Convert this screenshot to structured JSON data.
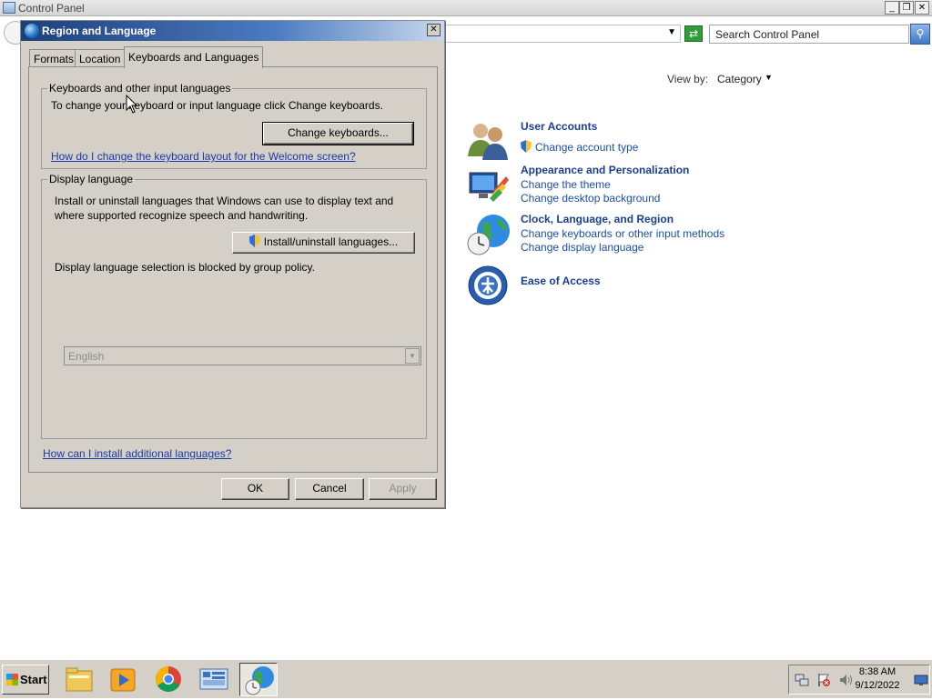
{
  "control_panel": {
    "title": "Control Panel",
    "search_placeholder": "Search Control Panel",
    "view_by_label": "View by:",
    "view_by_value": "Category",
    "categories": [
      {
        "title": "User Accounts",
        "links": [
          "Change account type"
        ]
      },
      {
        "title": "Appearance and Personalization",
        "links": [
          "Change the theme",
          "Change desktop background"
        ]
      },
      {
        "title": "Clock, Language, and Region",
        "links": [
          "Change keyboards or other input methods",
          "Change display language"
        ]
      },
      {
        "title": "Ease of Access",
        "links": []
      }
    ]
  },
  "dialog": {
    "title": "Region and Language",
    "tabs": [
      "Formats",
      "Location",
      "Keyboards and Languages"
    ],
    "active_tab": "Keyboards and Languages",
    "keyboards_group": {
      "legend": "Keyboards and other input languages",
      "text": "To change your keyboard or input language click Change keyboards.",
      "button": "Change keyboards...",
      "link": "How do I change the keyboard layout for the Welcome screen?"
    },
    "display_group": {
      "legend": "Display language",
      "text_line1": "Install or uninstall languages that Windows can use to display text and",
      "text_line2": "where supported recognize speech and handwriting.",
      "button": "Install/uninstall languages...",
      "policy_text": "Display language selection is blocked by group policy.",
      "selected_language": "English"
    },
    "bottom_link": "How can I install additional languages?",
    "buttons": {
      "ok": "OK",
      "cancel": "Cancel",
      "apply": "Apply"
    }
  },
  "taskbar": {
    "start_label": "Start",
    "clock_time": "8:38 AM",
    "clock_date": "9/12/2022"
  }
}
